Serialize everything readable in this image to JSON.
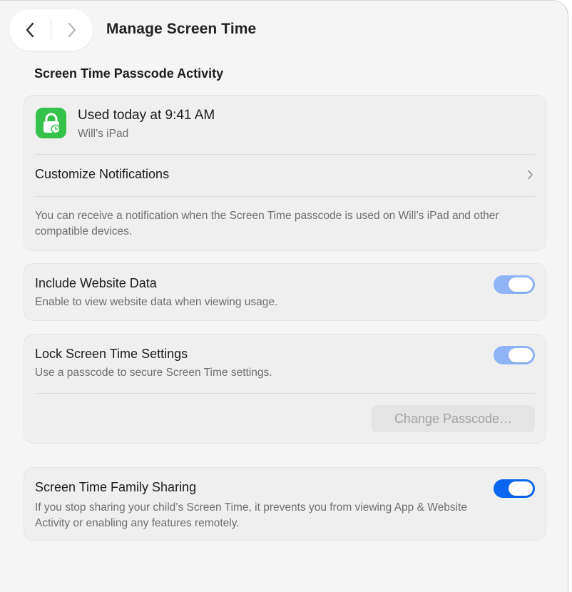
{
  "header": {
    "title": "Manage Screen Time",
    "back_icon": "chevron-left-icon",
    "forward_icon": "chevron-right-icon"
  },
  "activity": {
    "section_title": "Screen Time Passcode Activity",
    "icon": "lock-clock-icon",
    "icon_color": "#34c24a",
    "used_text": "Used today at 9:41 AM",
    "device": "Will’s iPad",
    "customize_label": "Customize Notifications",
    "footnote": "You can receive a notification when the Screen Time passcode is used on Will’s iPad and other compatible devices."
  },
  "website_data": {
    "title": "Include Website Data",
    "description": "Enable to view website data when viewing usage.",
    "toggle_on": true,
    "toggle_color": "#8fb4f6"
  },
  "lock_settings": {
    "title": "Lock Screen Time Settings",
    "description": "Use a passcode to secure Screen Time settings.",
    "toggle_on": true,
    "toggle_color": "#8fb4f6",
    "change_button_label": "Change Passcode…",
    "change_button_enabled": false
  },
  "family_sharing": {
    "title": "Screen Time Family Sharing",
    "description": "If you stop sharing your child’s Screen Time, it prevents you from viewing App & Website Activity or enabling any features remotely.",
    "toggle_on": true,
    "toggle_color": "#0a66f0"
  }
}
